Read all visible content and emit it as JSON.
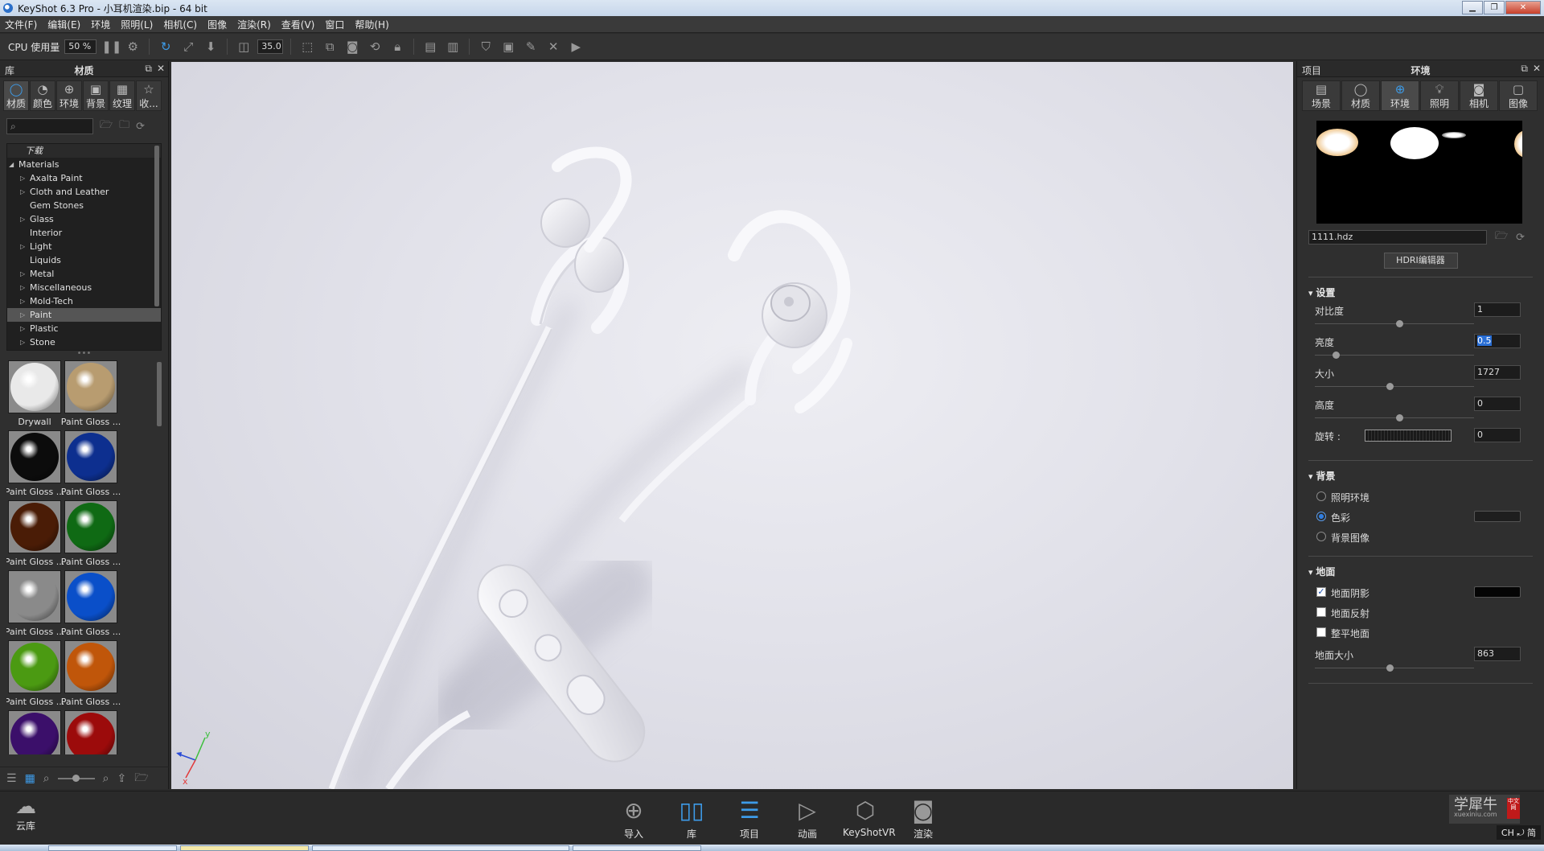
{
  "window": {
    "title": "KeyShot 6.3 Pro  - 小耳机渲染.bip  - 64 bit"
  },
  "menu": [
    "文件(F)",
    "编辑(E)",
    "环境",
    "照明(L)",
    "相机(C)",
    "图像",
    "渲染(R)",
    "查看(V)",
    "窗口",
    "帮助(H)"
  ],
  "toolbar": {
    "cpu_label": "CPU 使用量",
    "cpu_value": "50 %",
    "fov_value": "35.0"
  },
  "left_panel": {
    "header_left": "库",
    "header_title": "材质",
    "tabs": [
      {
        "label": "材质",
        "icon": "material-icon"
      },
      {
        "label": "颜色",
        "icon": "color-icon"
      },
      {
        "label": "环境",
        "icon": "environment-icon"
      },
      {
        "label": "背景",
        "icon": "background-icon"
      },
      {
        "label": "纹理",
        "icon": "texture-icon"
      },
      {
        "label": "收...",
        "icon": "favorites-icon"
      }
    ],
    "search_placeholder": "",
    "tree": {
      "download": "下载",
      "root": "Materials",
      "items": [
        "Axalta Paint",
        "Cloth and Leather",
        "Gem Stones",
        "Glass",
        "Interior",
        "Light",
        "Liquids",
        "Metal",
        "Miscellaneous",
        "Mold-Tech",
        "Paint",
        "Plastic",
        "Stone"
      ],
      "selected": "Paint"
    },
    "thumbnails": [
      {
        "label": "Drywall",
        "color": "#e9e9e9"
      },
      {
        "label": "Paint Gloss ...",
        "color": "#b89c70"
      },
      {
        "label": "Paint Gloss ...",
        "color": "#0c0c0c"
      },
      {
        "label": "Paint Gloss ...",
        "color": "#0d2f8f"
      },
      {
        "label": "Paint Gloss ...",
        "color": "#4a1c06"
      },
      {
        "label": "Paint Gloss ...",
        "color": "#0f6a14"
      },
      {
        "label": "Paint Gloss ...",
        "color": "#8a8a8a"
      },
      {
        "label": "Paint Gloss ...",
        "color": "#0a4fc9"
      },
      {
        "label": "Paint Gloss ...",
        "color": "#4b9a12"
      },
      {
        "label": "Paint Gloss ...",
        "color": "#c0560a"
      },
      {
        "label": "",
        "color": "#3b0f6a"
      },
      {
        "label": "",
        "color": "#9c0b0b"
      }
    ]
  },
  "right_panel": {
    "header_left": "项目",
    "header_title": "环境",
    "tabs": [
      {
        "label": "场景",
        "icon": "scene-icon"
      },
      {
        "label": "材质",
        "icon": "material-icon"
      },
      {
        "label": "环境",
        "icon": "environment-icon"
      },
      {
        "label": "照明",
        "icon": "lighting-icon"
      },
      {
        "label": "相机",
        "icon": "camera-icon"
      },
      {
        "label": "图像",
        "icon": "image-icon"
      }
    ],
    "hdri_file": "1111.hdz",
    "hdri_editor": "HDRI编辑器",
    "settings": {
      "title": "设置",
      "contrast_label": "对比度",
      "contrast": "1",
      "contrast_frac": 0.53,
      "brightness_label": "亮度",
      "brightness": "0.5",
      "brightness_frac": 0.13,
      "size_label": "大小",
      "size": "1727",
      "size_frac": 0.47,
      "height_label": "高度",
      "height": "0",
      "height_frac": 0.53,
      "rotation_label": "旋转 :",
      "rotation": "0"
    },
    "background": {
      "title": "背景",
      "options": [
        "照明环境",
        "色彩",
        "背景图像"
      ],
      "selected": "色彩",
      "color": "#1e1e1e"
    },
    "ground": {
      "title": "地面",
      "shadow_label": "地面阴影",
      "shadow_checked": true,
      "shadow_color": "#050505",
      "reflection_label": "地面反射",
      "reflection_checked": false,
      "flatten_label": "整平地面",
      "flatten_checked": false,
      "size_label": "地面大小",
      "size": "863",
      "size_frac": 0.47
    }
  },
  "bottom_bar": {
    "cloud_label": "云库",
    "buttons": [
      {
        "label": "导入",
        "icon": "import-icon"
      },
      {
        "label": "库",
        "icon": "library-icon"
      },
      {
        "label": "项目",
        "icon": "project-icon"
      },
      {
        "label": "动画",
        "icon": "animation-icon"
      },
      {
        "label": "KeyShotVR",
        "icon": "keyshotvr-icon"
      },
      {
        "label": "渲染",
        "icon": "render-icon"
      }
    ],
    "watermark": "学犀牛",
    "watermark_url": "xuexiniu.com",
    "watermark_tag": "中文网",
    "ime": "CH ⤾ 简"
  },
  "colors": {
    "accent": "#3d9be8",
    "viewport_bg": "#e4e4ec"
  }
}
